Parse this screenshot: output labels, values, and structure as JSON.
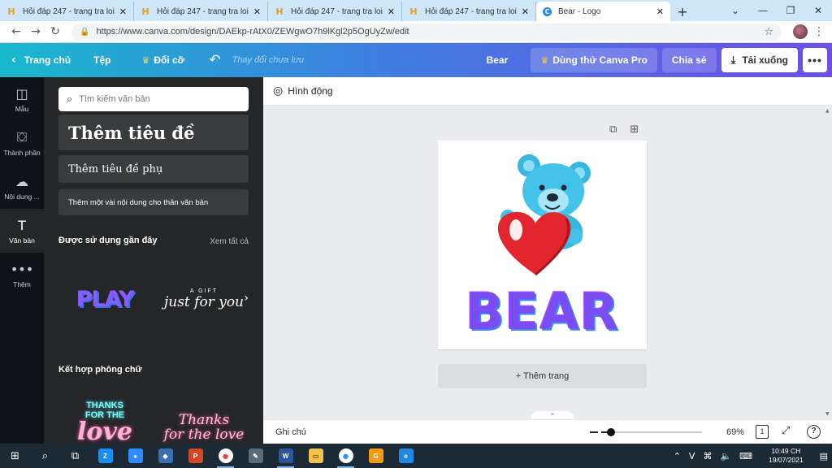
{
  "browser": {
    "tabs": [
      {
        "title": "Hỏi đáp 247 - trang tra loi",
        "favicon": "H",
        "active": false
      },
      {
        "title": "Hỏi đáp 247 - trang tra loi",
        "favicon": "H",
        "active": false
      },
      {
        "title": "Hỏi đáp 247 - trang tra loi",
        "favicon": "H",
        "active": false
      },
      {
        "title": "Hỏi đáp 247 - trang tra loi",
        "favicon": "H",
        "active": false
      },
      {
        "title": "Bear - Logo",
        "favicon": "C",
        "active": true
      }
    ],
    "url": "https://www.canva.com/design/DAEkp-rAtX0/ZEWgwO7h9lKgl2p5OgUyZw/edit"
  },
  "header": {
    "home": "Trang chủ",
    "file": "Tệp",
    "resize": "Đổi cỡ",
    "unsaved": "Thay đổi chưa lưu",
    "design_name": "Bear",
    "try_pro": "Dùng thử Canva Pro",
    "share": "Chia sẻ",
    "download": "Tải xuống"
  },
  "rail": {
    "items": [
      {
        "label": "Mẫu",
        "icon": "template-icon"
      },
      {
        "label": "Thành phần",
        "icon": "elements-icon"
      },
      {
        "label": "Nội dung ...",
        "icon": "upload-icon"
      },
      {
        "label": "Văn bản",
        "icon": "text-icon"
      },
      {
        "label": "Thêm",
        "icon": "more-icon"
      }
    ]
  },
  "panel": {
    "search_placeholder": "Tìm kiếm văn bản",
    "add_heading": "Thêm tiêu đề",
    "add_subheading": "Thêm tiêu đề phụ",
    "add_body": "Thêm một vài nội dung cho thân văn bản",
    "recent_title": "Được sử dụng gần đây",
    "see_all": "Xem tất cả",
    "combos_title": "Kết hợp phông chữ",
    "templates": {
      "play": "PLAY",
      "gift_small": "A GIFT",
      "gift_script": "just for you",
      "thanks1_top": "THANKS",
      "thanks1_mid": "FOR THE",
      "thanks1_love": "love",
      "thanks2_line1": "Thanks",
      "thanks2_line2": "for the love"
    }
  },
  "toolbar": {
    "animate": "Hình động"
  },
  "canvas": {
    "bear_text": "BEAR",
    "add_page": "+ Thêm trang"
  },
  "footer": {
    "notes": "Ghi chú",
    "zoom_percent": 69,
    "zoom_label": "69%",
    "page_count": "1"
  },
  "taskbar": {
    "time": "10:49 CH",
    "date": "19/07/2021",
    "lang": "V"
  },
  "colors": {
    "header_start": "#19b8cc",
    "header_end": "#6f4ee8",
    "panel": "#252627",
    "rail": "#0e1318"
  }
}
